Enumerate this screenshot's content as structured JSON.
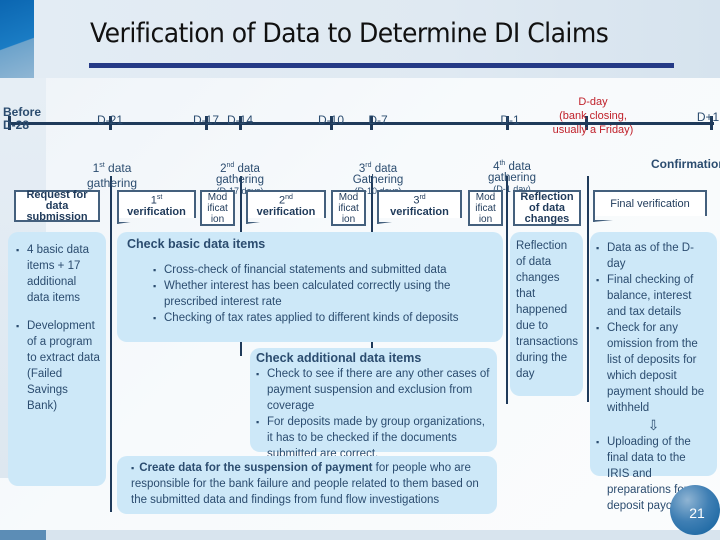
{
  "title": "Verification of Data to Determine DI Claims",
  "timeline": {
    "markers": [
      {
        "label": "Before D-28",
        "line1": "Before",
        "line2": "D-28"
      },
      {
        "label": "D-21"
      },
      {
        "label": "D-17"
      },
      {
        "label": "D-14"
      },
      {
        "label": "D-10"
      },
      {
        "label": "D-7"
      },
      {
        "label": "D-1"
      },
      {
        "label": "D-day (bank closing, usually a Friday)",
        "line1": "D-day",
        "line2": "(bank closing,",
        "line3": "usually a Friday)",
        "color": "#c0202a"
      },
      {
        "label": "D+1"
      }
    ],
    "phases": [
      {
        "ord": "1",
        "sup": "st",
        "text": " data",
        "line2": "gathering",
        "line3": ""
      },
      {
        "ord": "2",
        "sup": "nd",
        "text": " data",
        "line2": "gathering",
        "line3": "(D-17 days)"
      },
      {
        "ord": "3",
        "sup": "rd",
        "text": " data",
        "line2": "Gathering",
        "line3": "(D-10 days)"
      },
      {
        "ord": "4",
        "sup": "th",
        "text": " data",
        "line2": "gathering",
        "line3": "(D-1 day)"
      },
      {
        "ord": "",
        "sup": "",
        "text": "Confirmation",
        "line2": "",
        "line3": ""
      }
    ]
  },
  "steps": {
    "request": {
      "line1": "Request for",
      "line2": "data",
      "line3": "submission"
    },
    "verification1": {
      "ord": "1",
      "sup": "st",
      "label": "verification"
    },
    "modification1": {
      "line1": "Mod",
      "line2": "ificat",
      "line3": "ion"
    },
    "verification2": {
      "ord": "2",
      "sup": "nd",
      "label": "verification"
    },
    "modification2": {
      "line1": "Mod",
      "line2": "ificat",
      "line3": "ion"
    },
    "verification3": {
      "ord": "3",
      "sup": "rd",
      "label": "verification"
    },
    "modification3": {
      "line1": "Mod",
      "line2": "ificat",
      "line3": "ion"
    },
    "reflection": {
      "line1": "Reflection",
      "line2": "of data",
      "line3": "changes"
    },
    "final": {
      "label": "Final verification"
    }
  },
  "panels": {
    "left": {
      "items": [
        "4 basic data items + 17 additional data items",
        "Development of a program to extract data (Failed Savings Bank)"
      ]
    },
    "basic": {
      "title": "Check basic data items",
      "items": [
        "Cross-check of financial statements and submitted data",
        "Whether interest has been calculated correctly using the prescribed interest rate",
        "Checking of tax rates applied to different kinds of deposits"
      ]
    },
    "additional": {
      "title": "Check additional data items",
      "items": [
        "Check to see if there are any other cases of payment suspension and exclusion from coverage",
        "For deposits made by group organizations, it has to be checked if the documents submitted are correct."
      ]
    },
    "suspension": {
      "bold": "Create data for the suspension of payment",
      "rest": " for people who are responsible for the bank failure and people related to them based on the submitted data and findings from fund flow investigations"
    },
    "reflection": {
      "text": "Reflection of data changes that happened due to transactions during the day"
    },
    "final": {
      "items": [
        "Data as of the D-day",
        "Final checking of balance, interest and tax details",
        "Check for any omission from the list of deposits for which deposit payment should be withheld"
      ],
      "after_arrow": "Uploading of the final data to the IRIS and preparations for deposit payoffs"
    }
  },
  "page_number": "21"
}
